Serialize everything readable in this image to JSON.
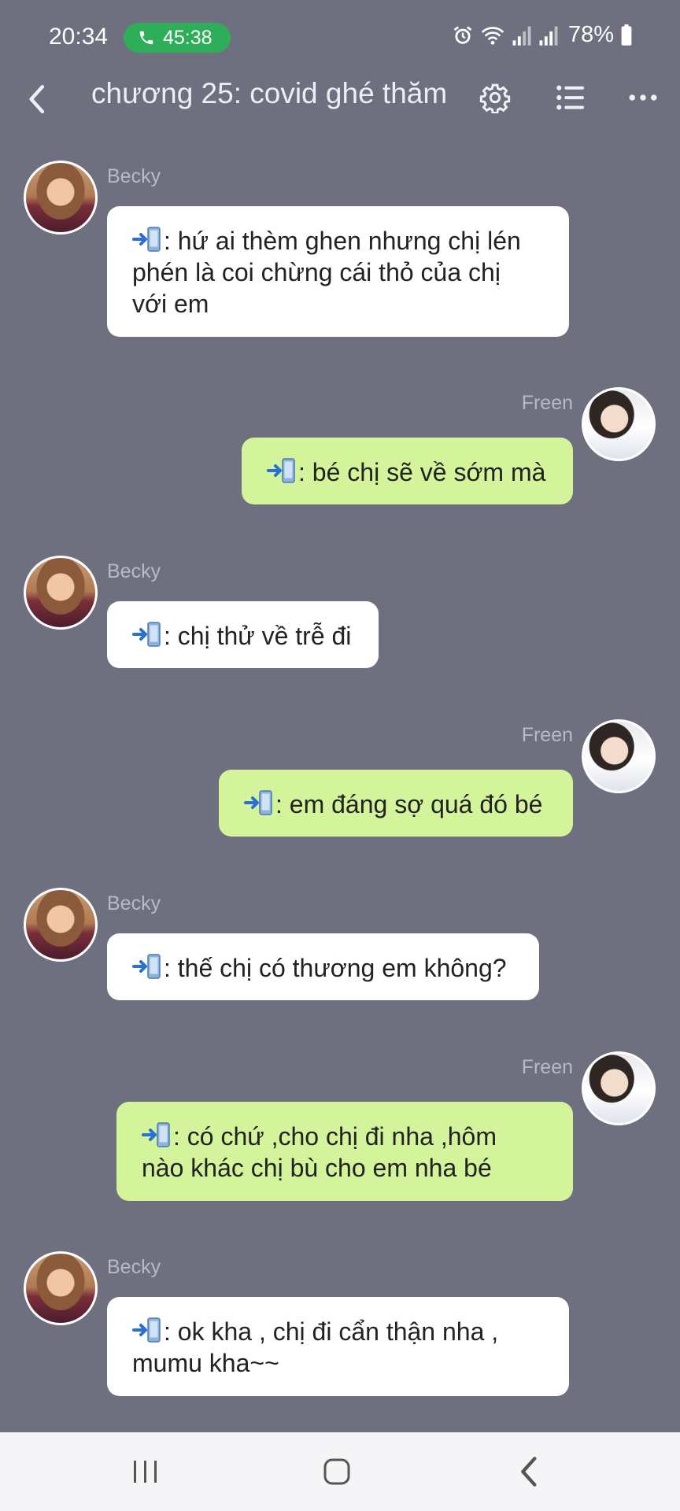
{
  "status_bar": {
    "time": "20:34",
    "call_duration": "45:38",
    "battery": "78%",
    "icons": [
      "alarm-icon",
      "wifi-icon",
      "signal-icon",
      "signal-icon",
      "battery-icon"
    ]
  },
  "header": {
    "title": "chương 25: covid ghé thăm",
    "icons": [
      "back-icon",
      "gear-icon",
      "list-icon",
      "more-icon"
    ]
  },
  "messages": [
    {
      "sender": "Becky",
      "side": "left",
      "lines": [
        ": hứ ai thèm ghen nhưng chị lén",
        "phén là coi chừng cái thỏ của chị",
        "với em"
      ]
    },
    {
      "sender": "Freen",
      "side": "right",
      "lines": [
        ": bé chị sẽ về sớm mà"
      ]
    },
    {
      "sender": "Becky",
      "side": "left",
      "lines": [
        ": chị thử về trễ đi"
      ]
    },
    {
      "sender": "Freen",
      "side": "right",
      "lines": [
        ": em đáng sợ quá đó bé"
      ]
    },
    {
      "sender": "Becky",
      "side": "left",
      "lines": [
        ": thế chị có thương em không?"
      ]
    },
    {
      "sender": "Freen",
      "side": "right",
      "lines": [
        ": có chứ ,cho chị đi nha ,hôm",
        "nào khác chị bù cho em nha bé"
      ]
    },
    {
      "sender": "Becky",
      "side": "left",
      "lines": [
        ": ok kha , chị đi cẩn thận nha ,",
        "mumu kha~~"
      ]
    }
  ],
  "nav_bar": {
    "icons": [
      "recents-icon",
      "home-icon",
      "back-icon"
    ]
  },
  "colors": {
    "background": "#6f707f",
    "left_bubble": "#ffffff",
    "right_bubble": "#d4f49c",
    "call_pill": "#2fae5a"
  }
}
